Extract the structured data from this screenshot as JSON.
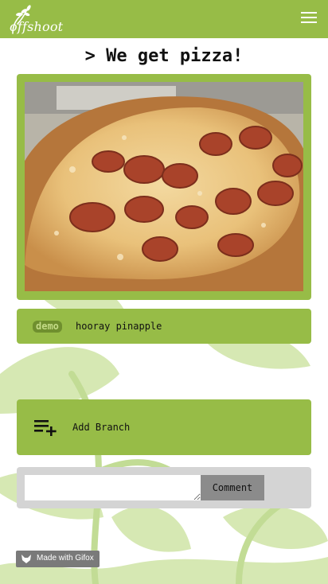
{
  "colors": {
    "brand": "#97bc47",
    "tag_bg": "#6f8f2e",
    "comment_panel": "#d4d4d4"
  },
  "header": {
    "logo_text": "offshoot",
    "menu_icon": "hamburger-menu-icon"
  },
  "post": {
    "title": "> We get pizza!",
    "image_subject": "pepperoni pizza",
    "tag": "demo",
    "caption": "hooray pinapple"
  },
  "actions": {
    "add_branch_label": "Add Branch",
    "add_branch_icon": "playlist-add-icon"
  },
  "comment": {
    "input_value": "",
    "button_label": "Comment"
  },
  "watermark": {
    "text": "Made with Gifox"
  }
}
